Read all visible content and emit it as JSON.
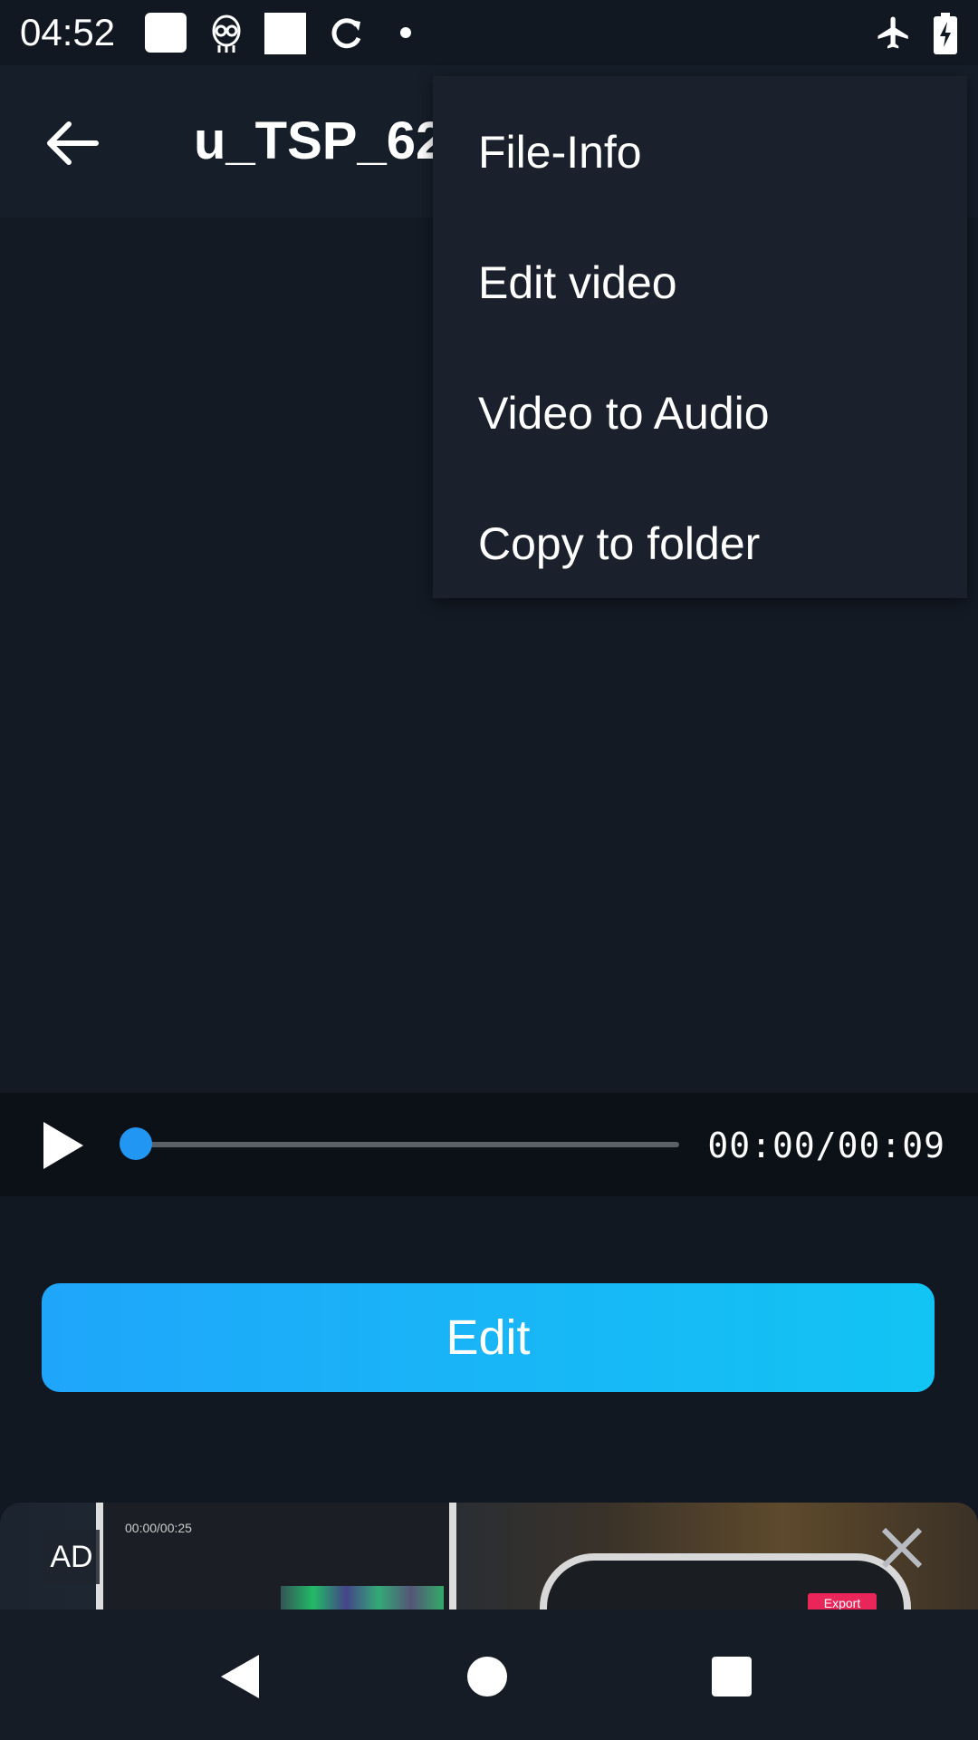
{
  "status_bar": {
    "time": "04:52"
  },
  "app_bar": {
    "title": "u_TSP_62"
  },
  "menu": {
    "items": [
      {
        "label": "File-Info"
      },
      {
        "label": "Edit video"
      },
      {
        "label": "Video to Audio"
      },
      {
        "label": "Copy to folder"
      }
    ]
  },
  "player": {
    "time_display": "00:00/00:09",
    "progress": 0.0
  },
  "actions": {
    "edit_label": "Edit"
  },
  "ad": {
    "label": "AD",
    "phone_time": "00:00/00:25",
    "export_label": "Export"
  },
  "colors": {
    "accent": "#2196f3",
    "button_gradient_start": "#1fa6fb",
    "button_gradient_end": "#12c4f3",
    "background": "#111821"
  }
}
